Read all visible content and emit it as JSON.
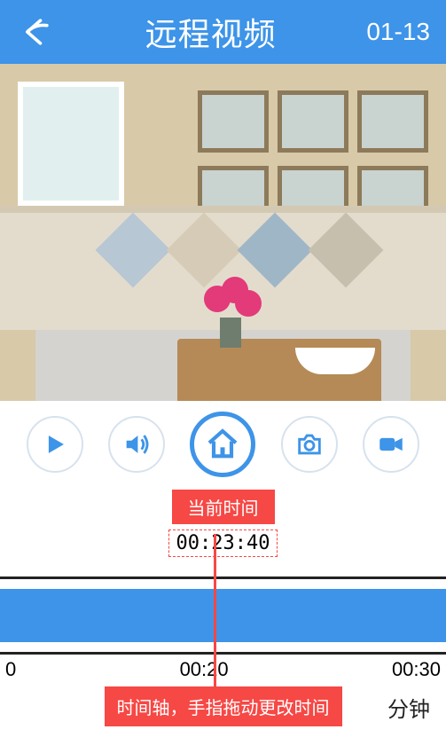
{
  "header": {
    "title": "远程视频",
    "date": "01-13"
  },
  "controls": {
    "play": "play",
    "sound": "sound",
    "home": "home",
    "snapshot": "snapshot",
    "record": "record"
  },
  "time": {
    "current_label": "当前时间",
    "current_value": "00:23:40",
    "hint": "时间轴，手指拖动更改时间",
    "unit": "分钟",
    "ticks": [
      "0",
      "00:20",
      "00:30"
    ]
  },
  "colors": {
    "primary": "#3d94e8",
    "accent": "#f64845"
  }
}
